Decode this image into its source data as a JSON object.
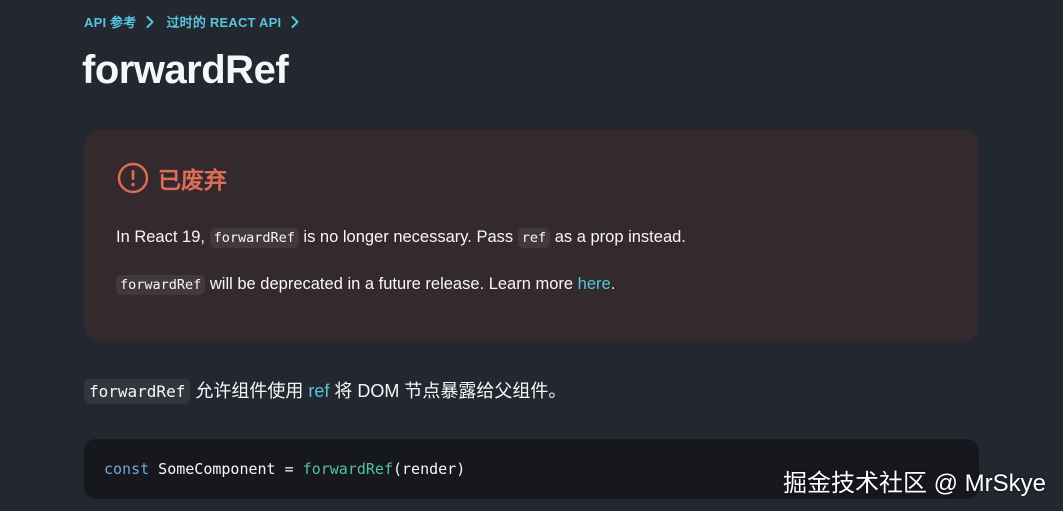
{
  "colors": {
    "background": "#23272f",
    "accent_link": "#58c4dc",
    "deprecation_bg": "#342a2e",
    "deprecation_title": "#e06c58",
    "code_bg": "#16181d"
  },
  "breadcrumb": {
    "items": [
      {
        "label": "API 参考",
        "icon": "chevron-right-icon"
      },
      {
        "label": "过时的 REACT API",
        "icon": "chevron-right-icon"
      }
    ]
  },
  "page": {
    "title": "forwardRef"
  },
  "deprecation": {
    "icon": "warning-circle-icon",
    "title": "已废弃",
    "line1": {
      "before": "In React 19, ",
      "code1": "forwardRef",
      "middle": " is no longer necessary. Pass ",
      "code2": "ref",
      "after": " as a prop instead."
    },
    "line2": {
      "code": "forwardRef",
      "text": " will be deprecated in a future release. Learn more ",
      "link": "here",
      "end": "."
    }
  },
  "intro": {
    "code": "forwardRef",
    "text1": " 允许组件使用 ",
    "link": "ref",
    "text2": " 将 DOM 节点暴露给父组件。"
  },
  "code_block": {
    "keyword": "const",
    "name": " SomeComponent = ",
    "fn": "forwardRef",
    "args": "(render)"
  },
  "watermark": "掘金技术社区 @ MrSkye"
}
